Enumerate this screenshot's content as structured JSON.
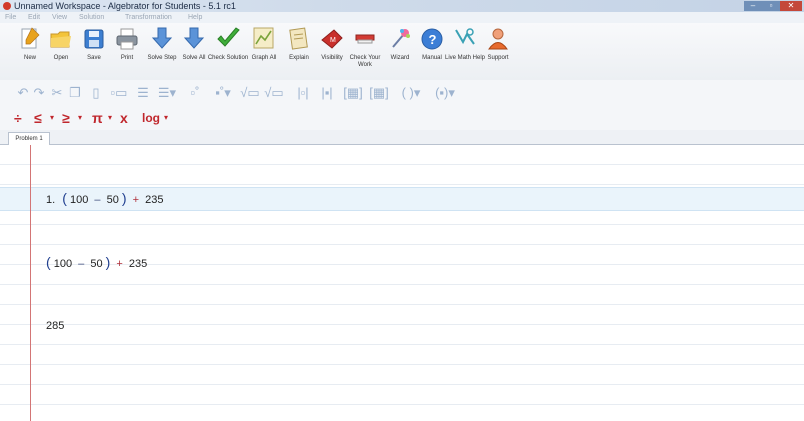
{
  "window": {
    "title": "Unnamed Workspace - Algebrator for Students - 5.1 rc1",
    "min_label": "–",
    "max_label": "▫",
    "close_label": "✕"
  },
  "menu": [
    "File",
    "Edit",
    "View",
    "Solution",
    "Transformation",
    "Help"
  ],
  "toolbar": {
    "new": "New",
    "open": "Open",
    "save": "Save",
    "print": "Print",
    "solve_step": "Solve Step",
    "solve_all": "Solve All",
    "check_solution": "Check Solution",
    "graph_all": "Graph All",
    "explain": "Explain",
    "visibility": "Visibility",
    "check_your_work": "Check Your Work",
    "wizard": "Wizard",
    "manual": "Manual",
    "live_math_help": "Live Math Help",
    "support": "Support"
  },
  "symbols": {
    "divide": "÷",
    "leq": "≤",
    "geq": "≥",
    "pi": "π",
    "subscript": "x",
    "log": "log"
  },
  "tabs": [
    "Problem 1"
  ],
  "workspace": {
    "line1": {
      "label": "1.",
      "open": "(",
      "a": "100",
      "minus": "–",
      "b": "50",
      "close": ")",
      "plus": "+",
      "c": "235"
    },
    "line2": {
      "open": "(",
      "a": "100",
      "minus": "–",
      "b": "50",
      "close": ")",
      "plus": "+",
      "c": "235"
    },
    "line3": {
      "result": "285"
    }
  },
  "colors": {
    "accent_red": "#c0272d",
    "margin_red": "#d37575",
    "highlight_blue": "#eaf4fb"
  }
}
